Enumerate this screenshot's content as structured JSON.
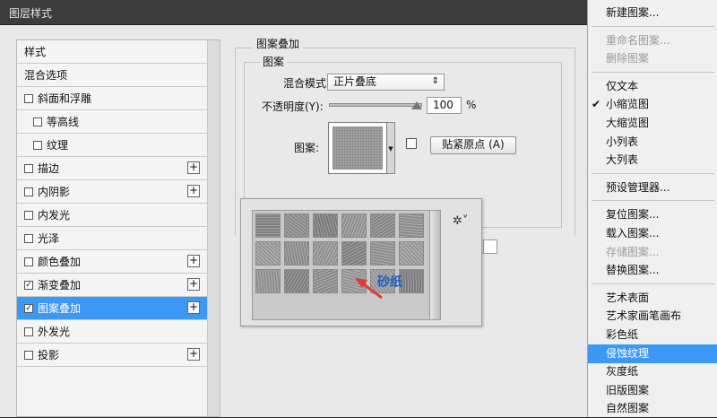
{
  "window": {
    "title": "图层样式"
  },
  "styles_list": {
    "items": [
      {
        "label": "样式",
        "checkbox": false,
        "plus": false,
        "indent": 0,
        "checked": false
      },
      {
        "label": "混合选项",
        "checkbox": false,
        "plus": false,
        "indent": 0,
        "checked": false
      },
      {
        "label": "斜面和浮雕",
        "checkbox": true,
        "plus": false,
        "indent": 0,
        "checked": false
      },
      {
        "label": "等高线",
        "checkbox": true,
        "plus": false,
        "indent": 1,
        "checked": false
      },
      {
        "label": "纹理",
        "checkbox": true,
        "plus": false,
        "indent": 1,
        "checked": false
      },
      {
        "label": "描边",
        "checkbox": true,
        "plus": true,
        "indent": 0,
        "checked": false
      },
      {
        "label": "内阴影",
        "checkbox": true,
        "plus": true,
        "indent": 0,
        "checked": false
      },
      {
        "label": "内发光",
        "checkbox": true,
        "plus": false,
        "indent": 0,
        "checked": false
      },
      {
        "label": "光泽",
        "checkbox": true,
        "plus": false,
        "indent": 0,
        "checked": false
      },
      {
        "label": "颜色叠加",
        "checkbox": true,
        "plus": true,
        "indent": 0,
        "checked": false
      },
      {
        "label": "渐变叠加",
        "checkbox": true,
        "plus": true,
        "indent": 0,
        "checked": true
      },
      {
        "label": "图案叠加",
        "checkbox": true,
        "plus": true,
        "indent": 0,
        "checked": true,
        "selected": true
      },
      {
        "label": "外发光",
        "checkbox": true,
        "plus": false,
        "indent": 0,
        "checked": false
      },
      {
        "label": "投影",
        "checkbox": true,
        "plus": true,
        "indent": 0,
        "checked": false
      }
    ]
  },
  "pattern_overlay": {
    "group_title": "图案叠加",
    "sub_title": "图案",
    "blend_label": "混合模式:",
    "blend_value": "正片叠底",
    "opacity_label": "不透明度(Y):",
    "opacity_value": "100",
    "opacity_unit": "%",
    "opacity_level": 1.0,
    "pattern_label": "图案:",
    "snap_button": "贴紧原点 (A)"
  },
  "picker": {
    "annotation": "砂纸",
    "swatch_colors": [
      "#8f8f8f",
      "#9a9a9a",
      "#8a8a8a",
      "#a2a2a2",
      "#959595",
      "#9e9e9e",
      "#a8a8a8",
      "#9b9b9b",
      "#a3a3a3",
      "#8e8e8e",
      "#9f9f9f",
      "#a9a9a9",
      "#a0a0a0",
      "#8d8d8d",
      "#9c9c9c",
      "#a5a5a5",
      "#a7a7a7",
      "#8b8b8b"
    ]
  },
  "menu": {
    "items": [
      {
        "label": "新建图案...",
        "state": "normal"
      },
      {
        "sep": true
      },
      {
        "label": "重命名图案...",
        "state": "disabled"
      },
      {
        "label": "删除图案",
        "state": "disabled"
      },
      {
        "sep": true
      },
      {
        "label": "仅文本",
        "state": "normal"
      },
      {
        "label": "小缩览图",
        "state": "checked"
      },
      {
        "label": "大缩览图",
        "state": "normal"
      },
      {
        "label": "小列表",
        "state": "normal"
      },
      {
        "label": "大列表",
        "state": "normal"
      },
      {
        "sep": true
      },
      {
        "label": "预设管理器...",
        "state": "normal"
      },
      {
        "sep": true
      },
      {
        "label": "复位图案...",
        "state": "normal"
      },
      {
        "label": "载入图案...",
        "state": "normal"
      },
      {
        "label": "存储图案...",
        "state": "disabled"
      },
      {
        "label": "替换图案...",
        "state": "normal"
      },
      {
        "sep": true
      },
      {
        "label": "艺术表面",
        "state": "normal"
      },
      {
        "label": "艺术家画笔画布",
        "state": "normal"
      },
      {
        "label": "彩色纸",
        "state": "normal"
      },
      {
        "label": "侵蚀纹理",
        "state": "highlighted"
      },
      {
        "label": "灰度纸",
        "state": "normal"
      },
      {
        "label": "旧版图案",
        "state": "normal"
      },
      {
        "label": "自然图案",
        "state": "normal"
      }
    ]
  },
  "colors": {
    "selection": "#3b98f5",
    "arrow": "#e53935",
    "annotation": "#1e5fbf"
  }
}
